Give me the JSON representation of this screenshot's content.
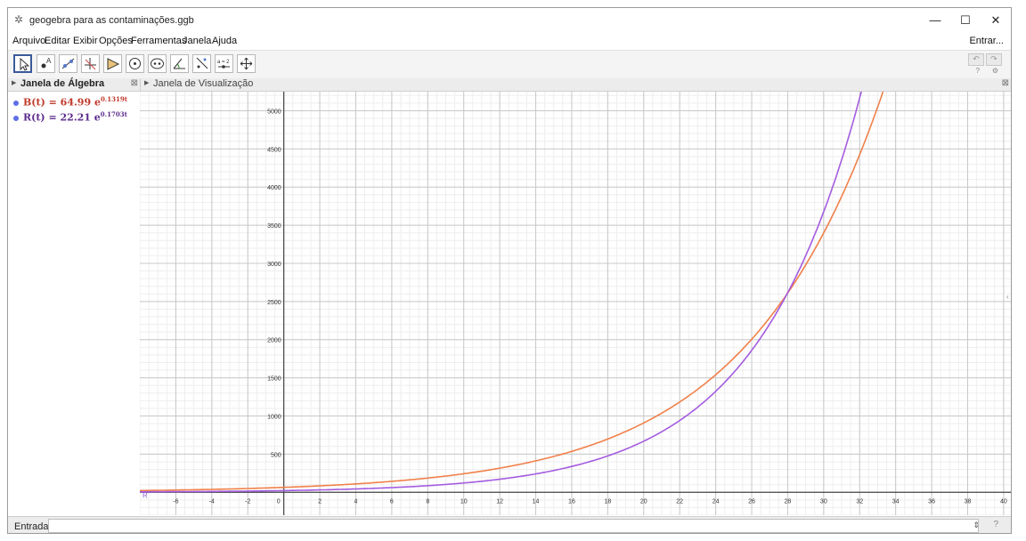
{
  "window": {
    "title": "geogebra para as contaminações.ggb",
    "minimize_glyph": "—",
    "maximize_glyph": "☐",
    "close_glyph": "✕"
  },
  "menu": {
    "items": [
      "Arquivo",
      "Editar",
      "Exibir",
      "Opções",
      "Ferramentas",
      "Janela",
      "Ajuda"
    ],
    "signin": "Entrar..."
  },
  "toolbar": {
    "tools": [
      "move-tool",
      "point-tool",
      "line-tool",
      "perpendicular-tool",
      "polygon-tool",
      "circle-tool",
      "conic-tool",
      "angle-tool",
      "reflect-tool",
      "slider-tool",
      "move-graphics-tool"
    ],
    "slider_label": "a = 2",
    "undo_glyph": "↶",
    "redo_glyph": "↷",
    "help_glyph": "?",
    "settings_glyph": "⚙"
  },
  "algebra": {
    "title": "Janela de Álgebra",
    "close_glyph": "⊠",
    "entries": [
      {
        "lhs": "B(t) = 64.99 e",
        "exp": "0.1319t",
        "color": "#c0392b"
      },
      {
        "lhs": "R(t) = 22.21 e",
        "exp": "0.1703t",
        "color": "#5b2b8c"
      }
    ]
  },
  "graphics": {
    "title": "Janela de Visualização",
    "close_glyph": "⊠",
    "axis_origin_label": "R"
  },
  "chart_data": {
    "type": "line",
    "xlim": [
      -8,
      40.5
    ],
    "ylim": [
      -300,
      5250
    ],
    "x_ticks": [
      -6,
      -4,
      -2,
      0,
      2,
      4,
      6,
      8,
      10,
      12,
      14,
      16,
      18,
      20,
      22,
      24,
      26,
      28,
      30,
      32,
      34,
      36,
      38,
      40
    ],
    "y_ticks": [
      500,
      1000,
      1500,
      2000,
      2500,
      3000,
      3500,
      4000,
      4500,
      5000
    ],
    "grid": true,
    "series": [
      {
        "name": "B(t)",
        "a": 64.99,
        "k": 0.1319,
        "color": "#f0804a"
      },
      {
        "name": "R(t)",
        "a": 22.21,
        "k": 0.1703,
        "color": "#a45ce0"
      }
    ]
  },
  "input": {
    "label": "Entrada:",
    "value": "",
    "arrows_glyph": "⇕",
    "help_glyph": "?"
  }
}
